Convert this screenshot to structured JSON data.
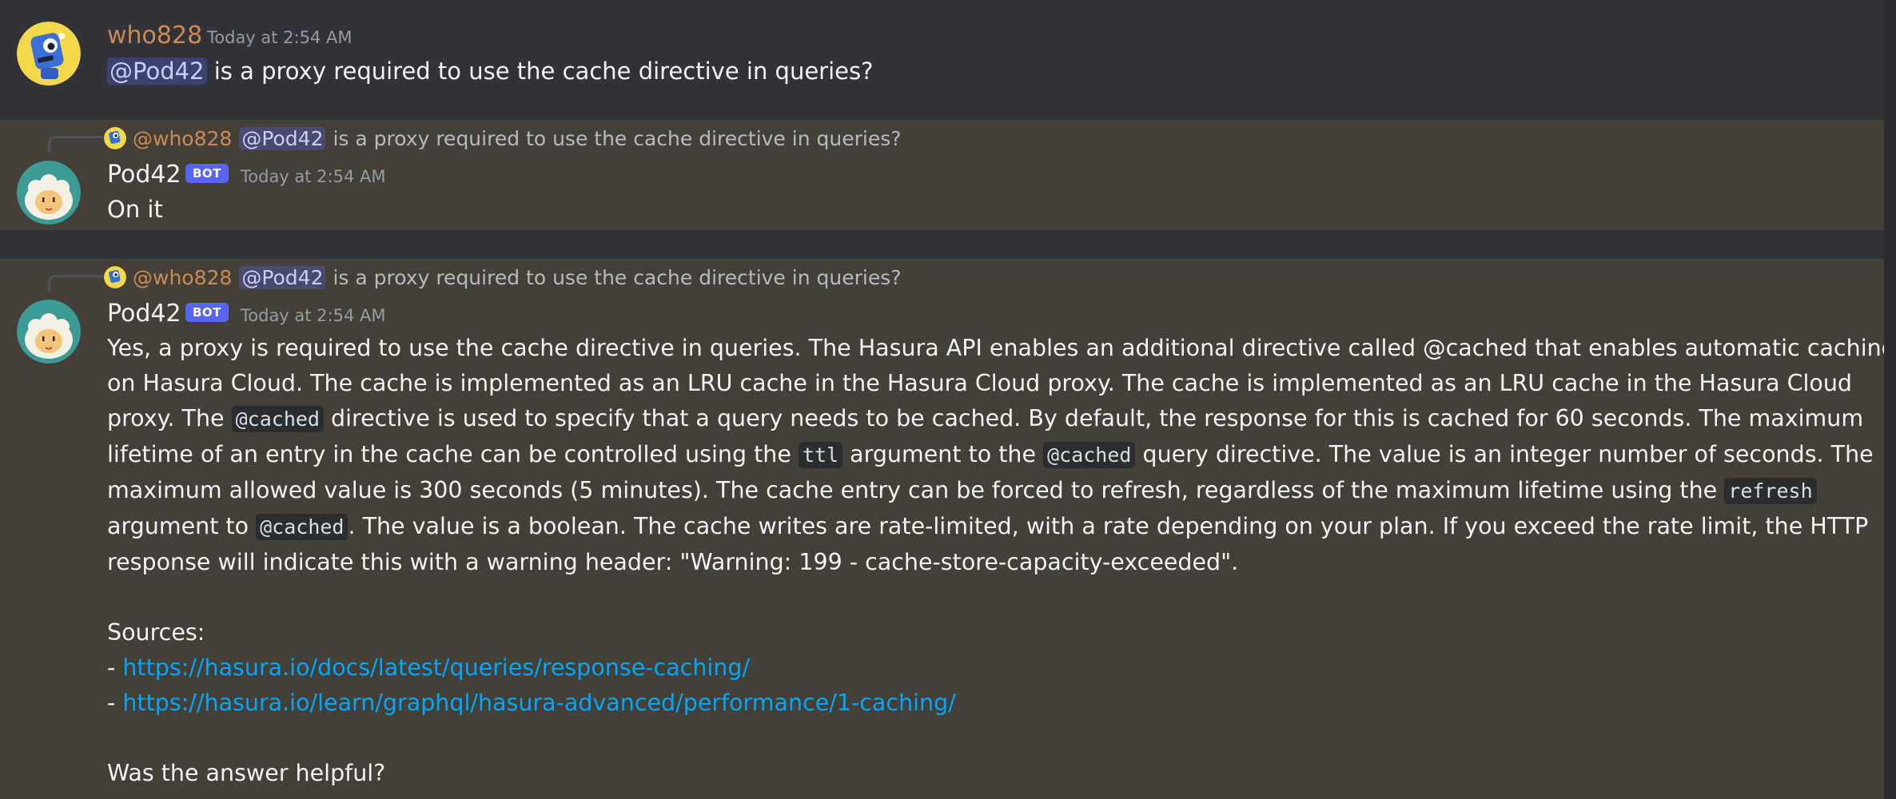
{
  "colors": {
    "background": "#323339",
    "highlight": "#444038",
    "who828_name": "#c98a55",
    "mention_bg": "#4a4f8c",
    "link": "#00a8fc",
    "bot_tag": "#5865f2"
  },
  "messages": [
    {
      "author": "who828",
      "avatar_icon": "blue-robot-avatar-icon",
      "timestamp": "Today at 2:54 AM",
      "mention": "@Pod42",
      "text": "is a proxy required to use the cache directive in queries?"
    },
    {
      "author": "Pod42",
      "avatar_icon": "sheep-avatar-icon",
      "bot_tag": "BOT",
      "timestamp": "Today at 2:54 AM",
      "reply": {
        "author": "@who828",
        "mention": "@Pod42",
        "text": "is a proxy required to use the cache directive in queries?"
      },
      "text": "On it"
    },
    {
      "author": "Pod42",
      "avatar_icon": "sheep-avatar-icon",
      "bot_tag": "BOT",
      "timestamp": "Today at 2:54 AM",
      "reply": {
        "author": "@who828",
        "mention": "@Pod42",
        "text": "is a proxy required to use the cache directive in queries?"
      },
      "body": {
        "l1": "Yes, a proxy is required to use the cache directive in queries. The Hasura API enables an additional directive called @cached that enables automatic caching",
        "l2": "on Hasura Cloud. The cache is implemented as an LRU cache in the Hasura Cloud proxy. The cache is implemented as an LRU cache in the Hasura Cloud",
        "l3a": "proxy. The ",
        "l3code": "@cached",
        "l3b": " directive is used to specify that a query needs to be cached. By default, the response for this is cached for 60 seconds. The maximum",
        "l4a": "lifetime of an entry in the cache can be controlled using the ",
        "l4code1": "ttl",
        "l4b": " argument to the ",
        "l4code2": "@cached",
        "l4c": " query directive. The value is an integer number of seconds. The",
        "l5a": "maximum allowed value is 300 seconds (5 minutes). The cache entry can be forced to refresh, regardless of the maximum lifetime using the ",
        "l5code": "refresh",
        "l6a": "argument to ",
        "l6code": "@cached",
        "l6b": ". The value is a boolean. The cache writes are rate-limited, with a rate depending on your plan. If you exceed the rate limit, the HTTP",
        "l7": "response will indicate this with a warning header: \"Warning: 199 - cache-store-capacity-exceeded\".",
        "sources_label": "Sources:",
        "bullet": "- ",
        "source1": "https://hasura.io/docs/latest/queries/response-caching/",
        "source2": "https://hasura.io/learn/graphql/hasura-advanced/performance/1-caching/",
        "helpful": "Was the answer helpful?"
      }
    }
  ]
}
